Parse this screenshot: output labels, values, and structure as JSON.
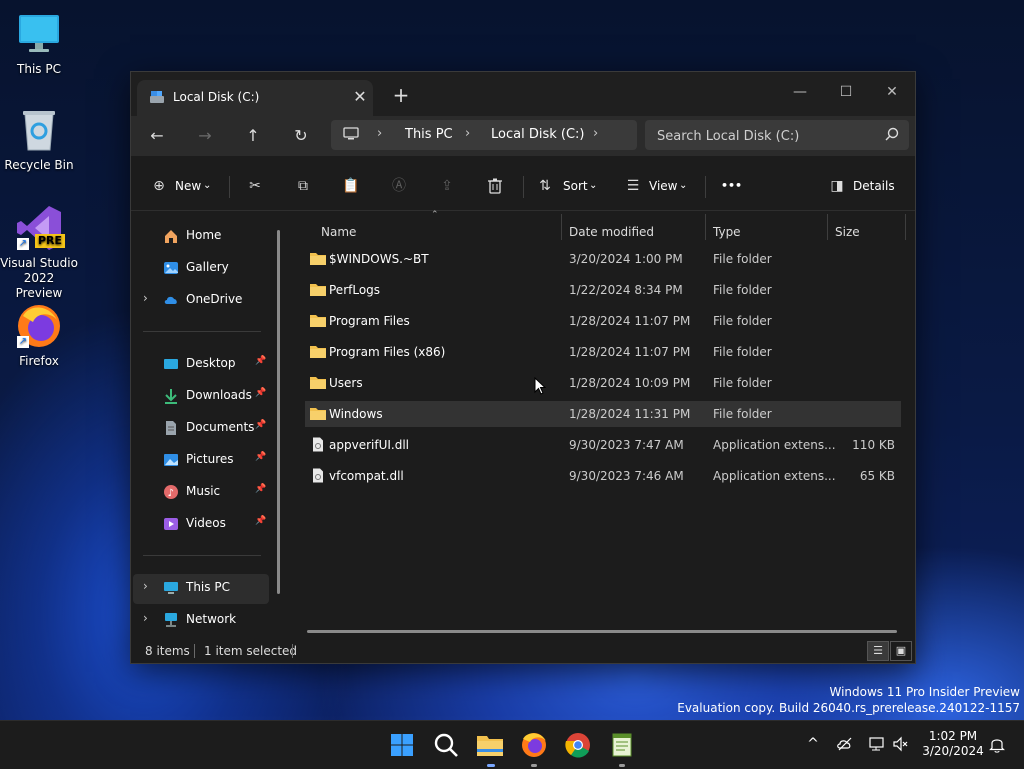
{
  "desktop": {
    "icons": [
      {
        "label": "This PC"
      },
      {
        "label": "Recycle Bin"
      },
      {
        "label": "Visual Studio 2022 Preview",
        "badge": "PRE"
      },
      {
        "label": "Firefox"
      }
    ]
  },
  "window": {
    "tab_title": "Local Disk (C:)",
    "tab_close": "✕",
    "new_tab": "+",
    "controls": {
      "minimize": "—",
      "maximize": "☐",
      "close": "✕"
    }
  },
  "navbar": {
    "back": "←",
    "forward": "→",
    "up": "↑",
    "refresh": "↻",
    "breadcrumb": [
      "This PC",
      "Local Disk (C:)"
    ],
    "search_placeholder": "Search Local Disk (C:)"
  },
  "commandbar": {
    "new_label": "New",
    "sort_label": "Sort",
    "view_label": "View",
    "more_label": "•••",
    "details_label": "Details"
  },
  "navpane": {
    "items": [
      {
        "label": "Home"
      },
      {
        "label": "Gallery"
      },
      {
        "label": "OneDrive"
      },
      {
        "label": "Desktop",
        "pin": "📌"
      },
      {
        "label": "Downloads",
        "pin": "📌"
      },
      {
        "label": "Documents",
        "pin": "📌"
      },
      {
        "label": "Pictures",
        "pin": "📌"
      },
      {
        "label": "Music",
        "pin": "📌"
      },
      {
        "label": "Videos",
        "pin": "📌"
      },
      {
        "label": "This PC"
      },
      {
        "label": "Network"
      }
    ]
  },
  "columns": {
    "name": "Name",
    "date": "Date modified",
    "type": "Type",
    "size": "Size"
  },
  "files": [
    {
      "name": "$WINDOWS.~BT",
      "date": "3/20/2024 1:00 PM",
      "type": "File folder",
      "size": ""
    },
    {
      "name": "PerfLogs",
      "date": "1/22/2024 8:34 PM",
      "type": "File folder",
      "size": ""
    },
    {
      "name": "Program Files",
      "date": "1/28/2024 11:07 PM",
      "type": "File folder",
      "size": ""
    },
    {
      "name": "Program Files (x86)",
      "date": "1/28/2024 11:07 PM",
      "type": "File folder",
      "size": ""
    },
    {
      "name": "Users",
      "date": "1/28/2024 10:09 PM",
      "type": "File folder",
      "size": ""
    },
    {
      "name": "Windows",
      "date": "1/28/2024 11:31 PM",
      "type": "File folder",
      "size": ""
    },
    {
      "name": "appverifUI.dll",
      "date": "9/30/2023 7:47 AM",
      "type": "Application extens...",
      "size": "110 KB"
    },
    {
      "name": "vfcompat.dll",
      "date": "9/30/2023 7:46 AM",
      "type": "Application extens...",
      "size": "65 KB"
    }
  ],
  "status": {
    "count": "8 items",
    "selected": "1 item selected"
  },
  "watermark": {
    "line1": "Windows 11 Pro Insider Preview",
    "line2": "Evaluation copy. Build 26040.rs_prerelease.240122-1157"
  },
  "taskbar": {
    "time": "1:02 PM",
    "date": "3/20/2024",
    "tray_chevron": "^"
  },
  "colors": {
    "accent": "#0078d4",
    "folder": "#f2c14e",
    "window_bg": "#1c1c1c"
  }
}
